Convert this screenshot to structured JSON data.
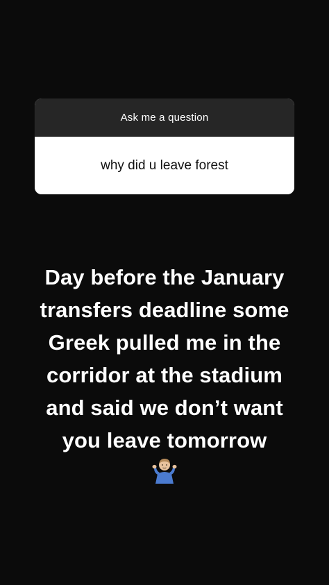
{
  "question_sticker": {
    "header": "Ask me a question",
    "question": "why did u leave forest"
  },
  "answer": {
    "lines": [
      "Day before the January",
      "transfers deadline some",
      "Greek pulled me in the",
      "corridor at the stadium",
      "and said we don’t want",
      "you leave tomorrow"
    ]
  },
  "emoji": {
    "icon": "person-shrugging-icon"
  }
}
